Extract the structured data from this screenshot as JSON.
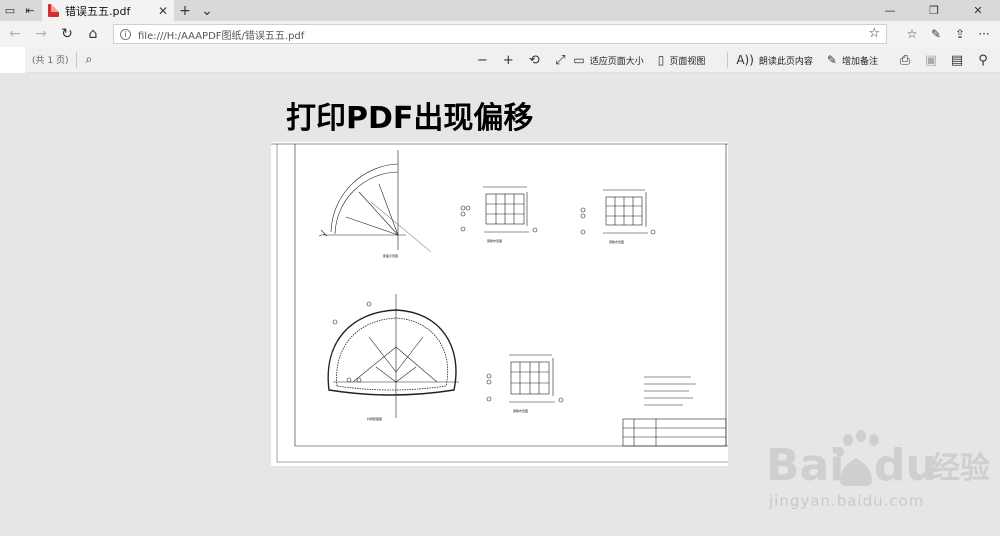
{
  "browser": {
    "tab_title": "错误五五.pdf",
    "address": "file:///H:/AAAPDF图纸/错误五五.pdf"
  },
  "pdf_toolbar": {
    "page_count": "(共 1 页)",
    "fit_page": "适应页面大小",
    "page_view": "页面视图",
    "read_aloud": "朗读此页内容",
    "add_notes": "增加备注"
  },
  "content": {
    "title": "打印PDF出现偏移"
  },
  "watermark": {
    "brand": "Bai",
    "brand2": "du",
    "cn": "经验",
    "url": "jingyan.baidu.com"
  },
  "colors": {
    "pdf_icon": "#d32f2f",
    "watermark": "#c9c9c9"
  }
}
